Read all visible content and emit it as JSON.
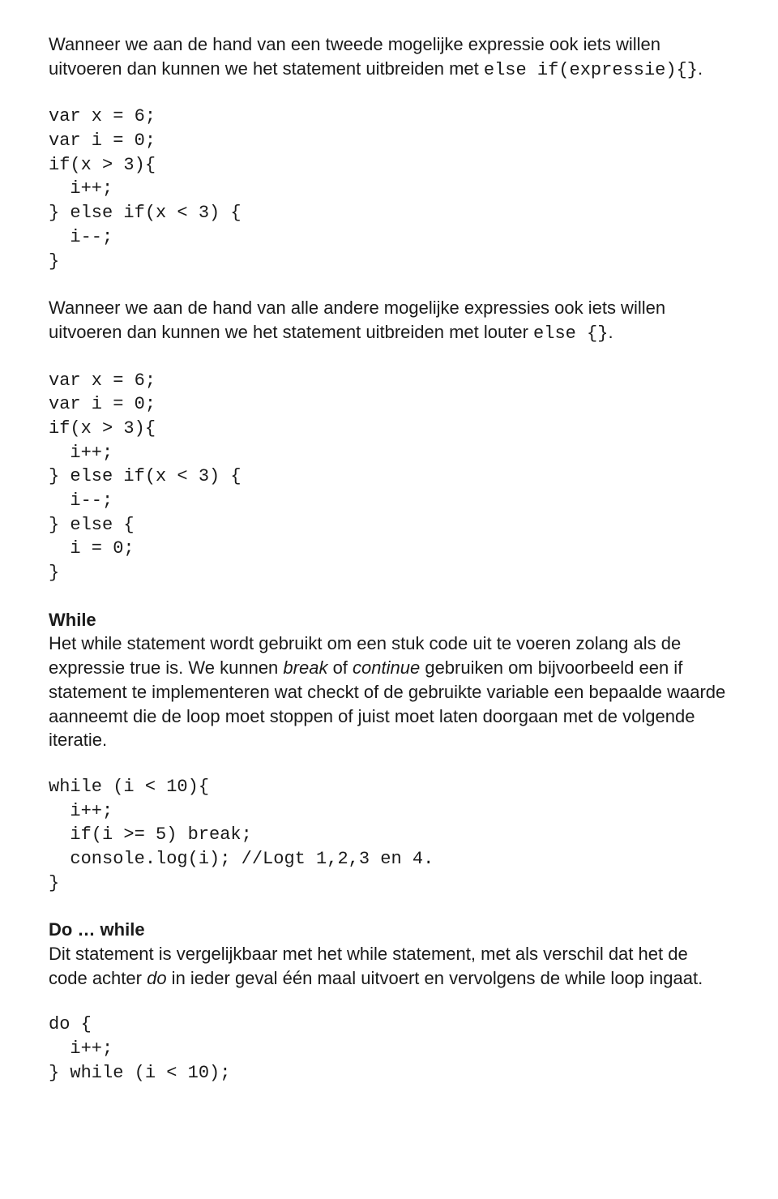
{
  "p1_a": "Wanneer we aan de hand van een tweede mogelijke expressie ook iets willen uitvoeren dan kunnen we het statement uitbreiden met ",
  "p1_code": "else if(expressie){}",
  "p1_b": ".",
  "code1": "var x = 6;\nvar i = 0;\nif(x > 3){\n  i++;\n} else if(x < 3) {\n  i--;\n}",
  "p2_a": "Wanneer we aan de hand van alle andere mogelijke expressies ook iets willen uitvoeren dan kunnen we het statement uitbreiden met  louter ",
  "p2_code": "else {}",
  "p2_b": ".",
  "code2": "var x = 6;\nvar i = 0;\nif(x > 3){\n  i++;\n} else if(x < 3) {\n  i--;\n} else {\n  i = 0;\n}",
  "h_while": "While",
  "p3_a": "Het while statement wordt gebruikt om een stuk code uit te voeren zolang als de expressie true is. We kunnen ",
  "p3_i1": "break",
  "p3_b": " of ",
  "p3_i2": "continue",
  "p3_c": " gebruiken om bijvoorbeeld een if statement te implementeren wat checkt of de gebruikte variable een bepaalde waarde aanneemt die de loop moet stoppen of juist moet laten doorgaan met de volgende iteratie.",
  "code3": "while (i < 10){\n  i++;\n  if(i >= 5) break;\n  console.log(i); //Logt 1,2,3 en 4.\n}",
  "h_dowhile": "Do … while",
  "p4_a": "Dit statement is vergelijkbaar met het while statement, met als verschil dat het de code achter ",
  "p4_i1": "do",
  "p4_b": " in ieder geval één maal uitvoert en vervolgens de while loop ingaat.",
  "code4": "do {\n  i++;\n} while (i < 10);"
}
